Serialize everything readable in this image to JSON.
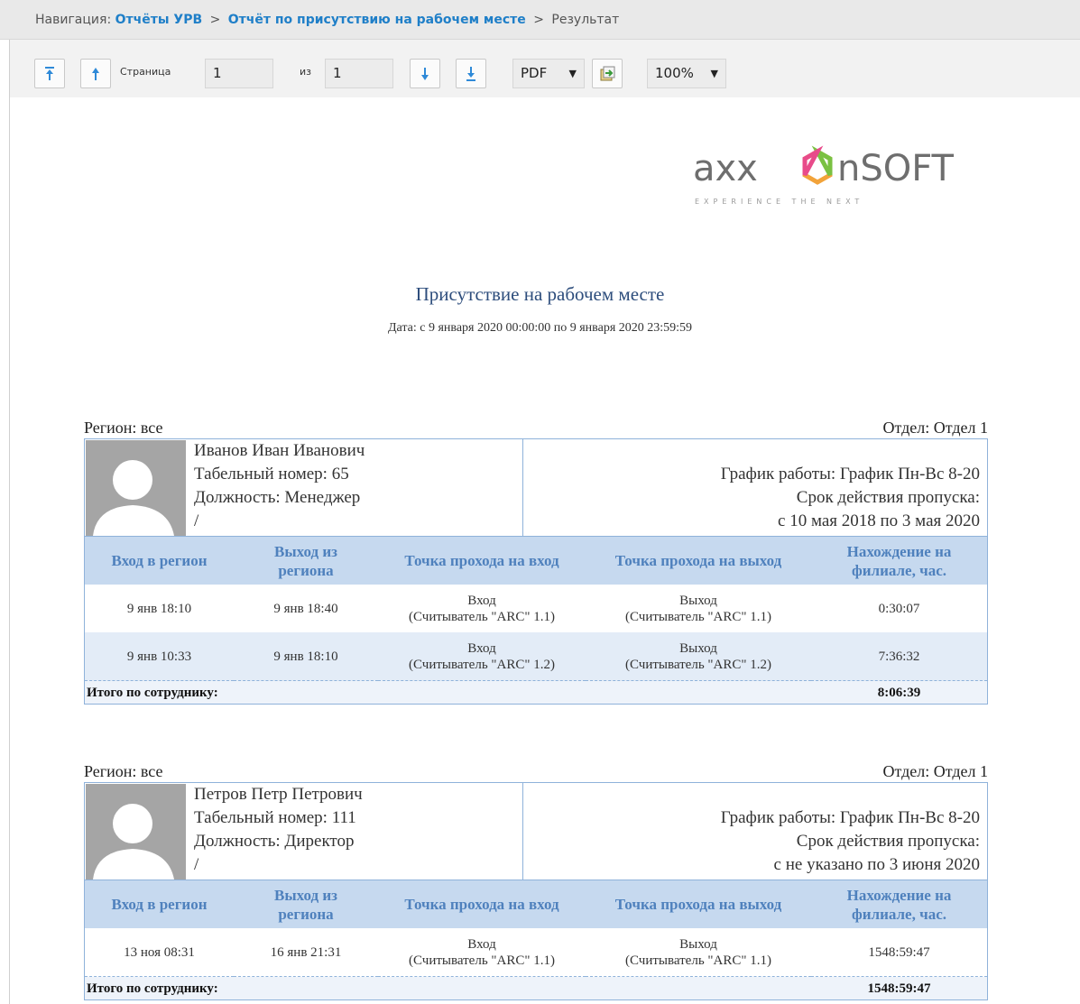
{
  "nav": {
    "prefix": "Навигация:",
    "link1": "Отчёты УРВ",
    "sep1": ">",
    "link2": "Отчёт по присутствию на рабочем месте",
    "sep2": ">",
    "current": "Результат"
  },
  "toolbar": {
    "page_label": "Страница",
    "page_value": "1",
    "of_label": "из",
    "total_pages": "1",
    "format": "PDF",
    "zoom": "100%"
  },
  "report": {
    "title": "Присутствие на рабочем месте",
    "date_range": "Дата: с 9 января 2020 00:00:00 по 9 января 2020 23:59:59",
    "columns": [
      "Вход в регион",
      "Выход из\nрегиона",
      "Точка прохода на вход",
      "Точка прохода на выход",
      "Нахождение на\nфилиале, час."
    ],
    "total_label": "Итого по сотруднику:",
    "employees": [
      {
        "region": "Регион: все",
        "department": "Отдел: Отдел 1",
        "name": "Иванов Иван Иванович",
        "tab_number": "Табельный номер: 65",
        "position": "Должность: Менеджер",
        "extra": "/",
        "schedule": "График работы: График Пн-Вс 8-20",
        "pass_validity_label": "Срок действия пропуска:",
        "pass_validity": "с 10 мая 2018 по 3 мая 2020",
        "rows": [
          {
            "in": "9 янв 18:10",
            "out": "9 янв 18:40",
            "entry_point": "Вход",
            "entry_reader": "(Считыватель \"ARC\" 1.1)",
            "exit_point": "Выход",
            "exit_reader": "(Считыватель \"ARC\" 1.1)",
            "duration": "0:30:07"
          },
          {
            "in": "9 янв 10:33",
            "out": "9 янв 18:10",
            "entry_point": "Вход",
            "entry_reader": "(Считыватель \"ARC\" 1.2)",
            "exit_point": "Выход",
            "exit_reader": "(Считыватель \"ARC\" 1.2)",
            "duration": "7:36:32"
          }
        ],
        "total": "8:06:39"
      },
      {
        "region": "Регион: все",
        "department": "Отдел: Отдел 1",
        "name": "Петров Петр Петрович",
        "tab_number": "Табельный номер: 111",
        "position": "Должность: Директор",
        "extra": "/",
        "schedule": "График работы: График Пн-Вс 8-20",
        "pass_validity_label": "Срок действия пропуска:",
        "pass_validity": "с не указано по 3 июня 2020",
        "rows": [
          {
            "in": "13 ноя 08:31",
            "out": "16 янв 21:31",
            "entry_point": "Вход",
            "entry_reader": "(Считыватель \"ARC\" 1.1)",
            "exit_point": "Выход",
            "exit_reader": "(Считыватель \"ARC\" 1.1)",
            "duration": "1548:59:47"
          }
        ],
        "total": "1548:59:47"
      }
    ]
  },
  "logo": {
    "text_left": "axx",
    "text_right": "nSOFT",
    "tagline": "EXPERIENCE THE NEXT"
  },
  "colors": {
    "accent": "#1f7fc8",
    "header_bg": "#c6d9ef",
    "header_text": "#4f81bd",
    "border": "#8fb2da"
  }
}
